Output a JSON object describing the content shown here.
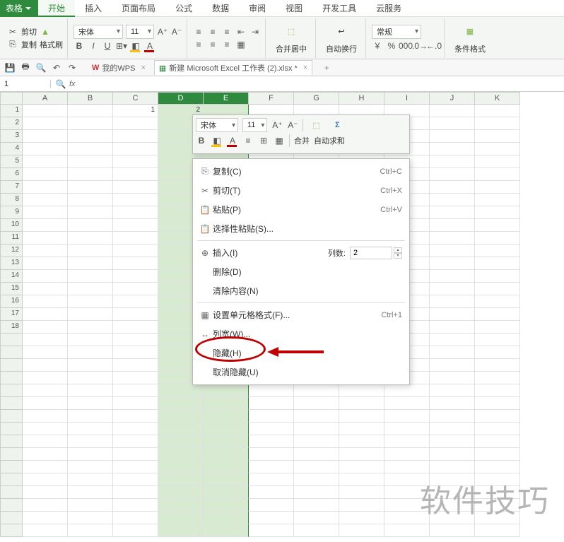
{
  "app_button": "表格",
  "menu": {
    "tabs": [
      "开始",
      "插入",
      "页面布局",
      "公式",
      "数据",
      "审阅",
      "视图",
      "开发工具",
      "云服务"
    ],
    "active": 0
  },
  "ribbon": {
    "cut": "剪切",
    "copy": "复制",
    "format_painter": "格式刷",
    "font_name": "宋体",
    "font_size": "11",
    "bold": "B",
    "italic": "I",
    "underline": "U",
    "merge": "合并居中",
    "wrap": "自动换行",
    "num_format": "常规",
    "cond_fmt": "条件格式"
  },
  "doctabs": {
    "wps": "我的WPS",
    "file": "新建 Microsoft Excel 工作表 (2).xlsx *"
  },
  "namebox": "1",
  "columns": [
    "A",
    "B",
    "C",
    "D",
    "E",
    "F",
    "G",
    "H",
    "I",
    "J",
    "K"
  ],
  "selected_cols": [
    "D",
    "E"
  ],
  "row_count": 34,
  "labeled_rows": 18,
  "cells": {
    "C1": "1",
    "D1": "2"
  },
  "mini": {
    "font": "宋体",
    "size": "11",
    "merge": "合并",
    "autosum": "自动求和"
  },
  "ctx": {
    "copy": "复制(C)",
    "copy_k": "Ctrl+C",
    "cut": "剪切(T)",
    "cut_k": "Ctrl+X",
    "paste": "粘贴(P)",
    "paste_k": "Ctrl+V",
    "paste_special": "选择性粘贴(S)...",
    "insert": "插入(I)",
    "cols_label": "列数:",
    "cols_val": "2",
    "delete": "删除(D)",
    "clear": "清除内容(N)",
    "format_cells": "设置单元格格式(F)...",
    "format_k": "Ctrl+1",
    "col_width": "列宽(W)...",
    "hide": "隐藏(H)",
    "unhide": "取消隐藏(U)"
  },
  "watermark": "软件技巧"
}
